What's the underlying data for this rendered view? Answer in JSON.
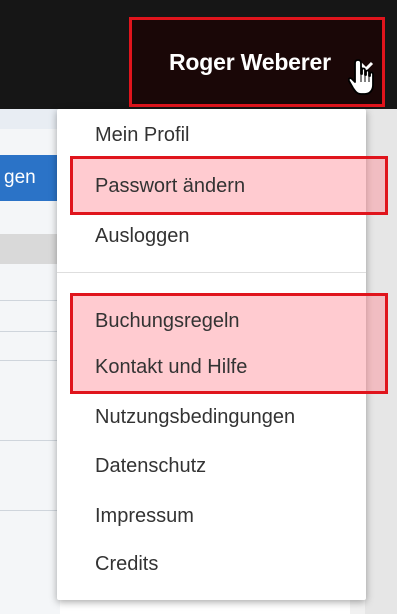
{
  "header": {
    "user_name": "Roger Weberer"
  },
  "background": {
    "button_fragment": "gen"
  },
  "menu": {
    "items": [
      {
        "label": "Mein Profil"
      },
      {
        "label": "Passwort ändern"
      },
      {
        "label": "Ausloggen"
      },
      {
        "label": "Buchungsregeln"
      },
      {
        "label": "Kontakt und Hilfe"
      },
      {
        "label": "Nutzungsbedingungen"
      },
      {
        "label": "Datenschutz"
      },
      {
        "label": "Impressum"
      },
      {
        "label": "Credits"
      }
    ]
  },
  "colors": {
    "highlight_border": "#e0141c",
    "highlight_fill": "#ffc4c9",
    "topbar": "#161616"
  },
  "icons": [
    "chevron-down-icon",
    "hand-cursor-icon"
  ]
}
